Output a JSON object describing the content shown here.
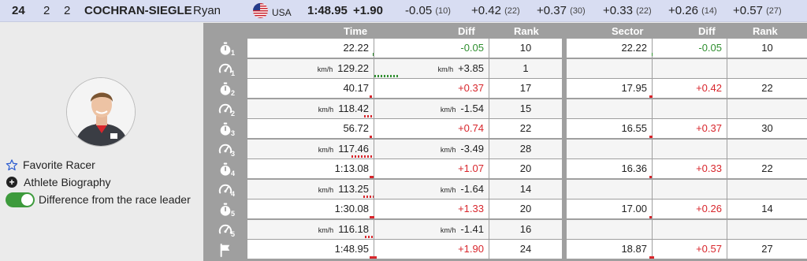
{
  "header": {
    "bib": "24",
    "run": "2",
    "col3": "2",
    "last_name": "COCHRAN-SIEGLE",
    "first_name": "Ryan",
    "country": "USA",
    "time": "1:48.95",
    "diff": "+1.90",
    "splits": [
      {
        "diff": "-0.05",
        "rank": "(10)"
      },
      {
        "diff": "+0.42",
        "rank": "(22)"
      },
      {
        "diff": "+0.37",
        "rank": "(30)"
      },
      {
        "diff": "+0.33",
        "rank": "(22)"
      },
      {
        "diff": "+0.26",
        "rank": "(14)"
      },
      {
        "diff": "+0.57",
        "rank": "(27)"
      }
    ]
  },
  "sidebar": {
    "favorite": "Favorite Racer",
    "bio": "Athlete Biography",
    "toggle_label": "Difference from the race leader",
    "toggle_on": true
  },
  "table": {
    "headers": {
      "time": "Time",
      "diff": "Diff",
      "rank": "Rank",
      "sector": "Sector",
      "sdiff": "Diff",
      "srank": "Rank"
    },
    "unit": "km/h",
    "rows": [
      {
        "icon": "stopwatch",
        "sub": "1",
        "time": "22.22",
        "diff": "-0.05",
        "rank": "10",
        "sector": "22.22",
        "sdiff": "-0.05",
        "srank": "10"
      },
      {
        "icon": "speed",
        "sub": "1",
        "time": "129.22",
        "diff": "+3.85",
        "rank": "1",
        "speed": true
      },
      {
        "icon": "stopwatch",
        "sub": "2",
        "time": "40.17",
        "diff": "+0.37",
        "rank": "17",
        "sector": "17.95",
        "sdiff": "+0.42",
        "srank": "22"
      },
      {
        "icon": "speed",
        "sub": "2",
        "time": "118.42",
        "diff": "-1.54",
        "rank": "15",
        "speed": true
      },
      {
        "icon": "stopwatch",
        "sub": "3",
        "time": "56.72",
        "diff": "+0.74",
        "rank": "22",
        "sector": "16.55",
        "sdiff": "+0.37",
        "srank": "30"
      },
      {
        "icon": "speed",
        "sub": "3",
        "time": "117.46",
        "diff": "-3.49",
        "rank": "28",
        "speed": true
      },
      {
        "icon": "stopwatch",
        "sub": "4",
        "time": "1:13.08",
        "diff": "+1.07",
        "rank": "20",
        "sector": "16.36",
        "sdiff": "+0.33",
        "srank": "22"
      },
      {
        "icon": "speed",
        "sub": "4",
        "time": "113.25",
        "diff": "-1.64",
        "rank": "14",
        "speed": true
      },
      {
        "icon": "stopwatch",
        "sub": "5",
        "time": "1:30.08",
        "diff": "+1.33",
        "rank": "20",
        "sector": "17.00",
        "sdiff": "+0.26",
        "srank": "14"
      },
      {
        "icon": "speed",
        "sub": "5",
        "time": "116.18",
        "diff": "-1.41",
        "rank": "16",
        "speed": true
      },
      {
        "icon": "finish-flag",
        "sub": "",
        "time": "1:48.95",
        "diff": "+1.90",
        "rank": "24",
        "sector": "18.87",
        "sdiff": "+0.57",
        "srank": "27"
      }
    ]
  }
}
